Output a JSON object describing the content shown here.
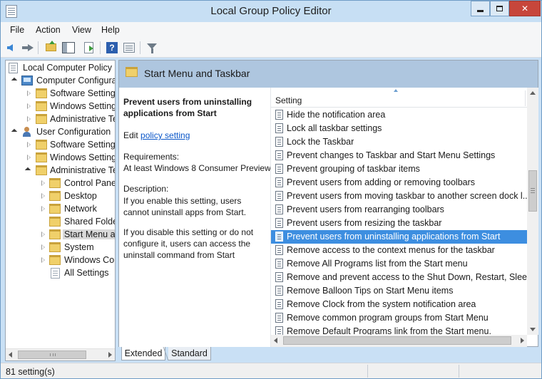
{
  "window": {
    "title": "Local Group Policy Editor"
  },
  "menu": [
    "File",
    "Action",
    "View",
    "Help"
  ],
  "toolbar_icons": [
    "back-arrow-icon",
    "forward-arrow-icon",
    "up-folder-icon",
    "show-hide-tree-icon",
    "export-list-icon",
    "help-icon",
    "properties-icon",
    "filter-icon"
  ],
  "tree": {
    "items": [
      {
        "label": "Local Computer Policy",
        "icon": "policy"
      },
      {
        "label": "Computer Configura",
        "icon": "computer"
      },
      {
        "label": "Software Settings",
        "icon": "folder"
      },
      {
        "label": "Windows Setting",
        "icon": "folder"
      },
      {
        "label": "Administrative Te",
        "icon": "folder"
      },
      {
        "label": "User Configuration",
        "icon": "user"
      },
      {
        "label": "Software Settings",
        "icon": "folder"
      },
      {
        "label": "Windows Setting",
        "icon": "folder"
      },
      {
        "label": "Administrative Te",
        "icon": "folder"
      },
      {
        "label": "Control Panel",
        "icon": "folder"
      },
      {
        "label": "Desktop",
        "icon": "folder"
      },
      {
        "label": "Network",
        "icon": "folder"
      },
      {
        "label": "Shared Folder",
        "icon": "folder"
      },
      {
        "label": "Start Menu ar",
        "icon": "folder",
        "selected": true
      },
      {
        "label": "System",
        "icon": "folder"
      },
      {
        "label": "Windows Cor",
        "icon": "folder"
      },
      {
        "label": "All Settings",
        "icon": "settings"
      }
    ]
  },
  "header": {
    "title": "Start Menu and Taskbar"
  },
  "description": {
    "title": "Prevent users from uninstalling applications from Start",
    "edit_prefix": "Edit",
    "edit_link": "policy setting",
    "requirements_label": "Requirements:",
    "requirements_value": "At least Windows 8 Consumer Preview",
    "description_label": "Description:",
    "para1": "If you enable this setting, users cannot uninstall apps from Start.",
    "para2": "If you disable this setting or do not configure it, users can access the uninstall command from Start"
  },
  "list": {
    "column": "Setting",
    "rows": [
      "Hide the notification area",
      "Lock all taskbar settings",
      "Lock the Taskbar",
      "Prevent changes to Taskbar and Start Menu Settings",
      "Prevent grouping of taskbar items",
      "Prevent users from adding or removing toolbars",
      "Prevent users from moving taskbar to another screen dock l...",
      "Prevent users from rearranging toolbars",
      "Prevent users from resizing the taskbar",
      "Prevent users from uninstalling applications from Start",
      "Remove access to the context menus for the taskbar",
      "Remove All Programs list from the Start menu",
      "Remove and prevent access to the Shut Down, Restart, Sleep...",
      "Remove Balloon Tips on Start Menu items",
      "Remove Clock from the system notification area",
      "Remove common program groups from Start Menu",
      "Remove Default Programs link from the Start menu."
    ],
    "selected_index": 9
  },
  "tabs": [
    "Extended",
    "Standard"
  ],
  "status": {
    "text": "81 setting(s)"
  },
  "colors": {
    "selection": "#3d8ee0",
    "header_band": "#aec6df",
    "window_frame": "#c9e0f5",
    "close_button": "#c7463b"
  }
}
